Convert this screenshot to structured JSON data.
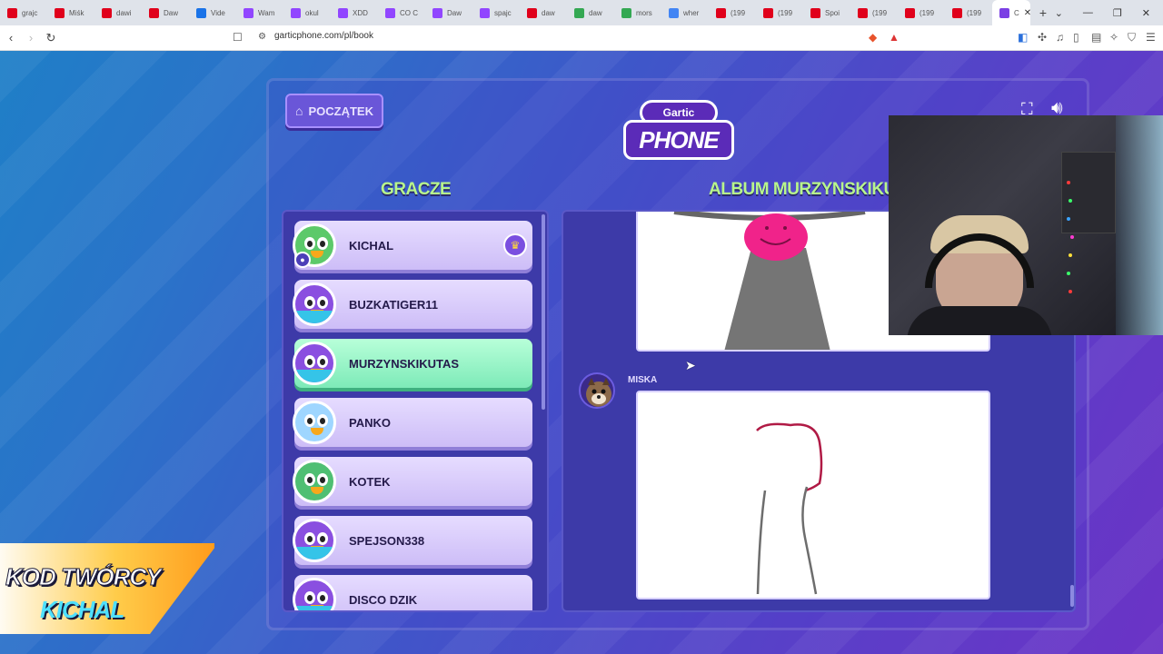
{
  "browser": {
    "tabs": [
      {
        "label": "grajc",
        "color": "#e0001b",
        "icon": "youtube-icon"
      },
      {
        "label": "Miśk",
        "color": "#e0001b",
        "icon": "youtube-icon"
      },
      {
        "label": "dawi",
        "color": "#e0001b",
        "icon": "youtube-icon"
      },
      {
        "label": "Daw",
        "color": "#e0001b",
        "icon": "youtube-icon"
      },
      {
        "label": "Vide",
        "color": "#1a73e8",
        "icon": "meta-icon"
      },
      {
        "label": "Wam",
        "color": "#9146ff",
        "icon": "twitch-icon"
      },
      {
        "label": "okul",
        "color": "#9146ff",
        "icon": "twitch-icon"
      },
      {
        "label": "XDD",
        "color": "#9146ff",
        "icon": "twitch-icon"
      },
      {
        "label": "CO C",
        "color": "#9146ff",
        "icon": "twitch-icon"
      },
      {
        "label": "Daw",
        "color": "#9146ff",
        "icon": "twitch-icon"
      },
      {
        "label": "spajc",
        "color": "#9146ff",
        "icon": "twitch-icon"
      },
      {
        "label": "daw",
        "color": "#e0001b",
        "icon": "youtube-icon"
      },
      {
        "label": "daw",
        "color": "#34a853",
        "icon": "drive-icon"
      },
      {
        "label": "mors",
        "color": "#34a853",
        "icon": "drive-icon"
      },
      {
        "label": "wher",
        "color": "#4285f4",
        "icon": "google-icon"
      },
      {
        "label": "(199",
        "color": "#e0001b",
        "icon": "youtube-icon"
      },
      {
        "label": "(199",
        "color": "#e0001b",
        "icon": "youtube-icon"
      },
      {
        "label": "Spoi",
        "color": "#e0001b",
        "icon": "youtube-icon"
      },
      {
        "label": "(199",
        "color": "#e0001b",
        "icon": "youtube-icon"
      },
      {
        "label": "(199",
        "color": "#e0001b",
        "icon": "youtube-icon"
      },
      {
        "label": "(199",
        "color": "#e0001b",
        "icon": "youtube-icon"
      }
    ],
    "active_tab": {
      "label": "C",
      "color": "#7b3fe4",
      "icon": "gartic-icon",
      "close": "✕"
    },
    "new_tab": "+",
    "url": "garticphone.com/pl/book"
  },
  "game": {
    "home_button": "POCZĄTEK",
    "logo": {
      "top": "Gartic",
      "main": "PHONE"
    },
    "players_title": "GRACZE",
    "album_title": "ALBUM MURZYNSKIKUTAS",
    "players": [
      {
        "name": "KICHAL",
        "host": true,
        "avatar": "alien-green"
      },
      {
        "name": "BUZKATIGER11",
        "avatar": "bird-purple"
      },
      {
        "name": "MURZYNSKIKUTAS",
        "highlighted": true,
        "avatar": "bird-purple"
      },
      {
        "name": "PANKO",
        "avatar": "yeti-blue"
      },
      {
        "name": "KOTEK",
        "avatar": "brain-green"
      },
      {
        "name": "SPEJSON338",
        "avatar": "bird-purple"
      },
      {
        "name": "DISCO DZIK",
        "avatar": "bird-purple"
      }
    ],
    "album_entry_author": "MISKA"
  },
  "promo": {
    "line1": "KOD TWÓRCY",
    "line2": "KICHAL"
  }
}
